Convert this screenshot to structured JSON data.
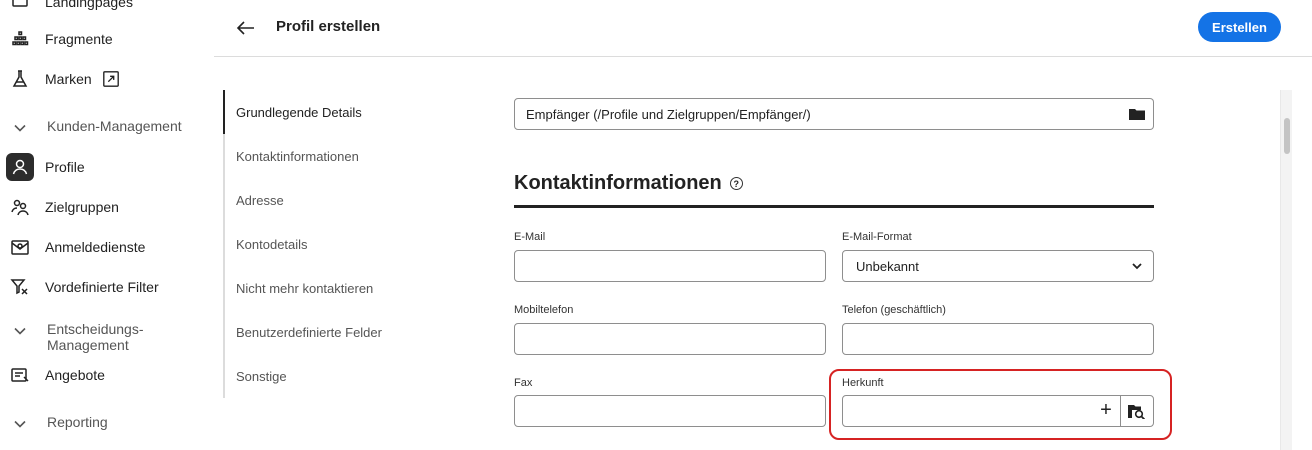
{
  "nav": {
    "items": [
      {
        "label": "Landingpages",
        "icon": "landing-page-icon"
      },
      {
        "label": "Fragmente",
        "icon": "fragment-icon"
      },
      {
        "label": "Marken",
        "icon": "brand-flask-icon"
      },
      {
        "label": "Profile",
        "icon": "user-icon",
        "active": true
      },
      {
        "label": "Zielgruppen",
        "icon": "audience-icon"
      },
      {
        "label": "Anmeldedienste",
        "icon": "subscription-icon"
      },
      {
        "label": "Vordefinierte Filter",
        "icon": "filter-icon"
      },
      {
        "label": "Angebote",
        "icon": "offer-icon"
      }
    ],
    "sections": [
      {
        "label": "Kunden-Management"
      },
      {
        "label": "Entscheidungs-\nManagement"
      },
      {
        "label": "Reporting"
      }
    ]
  },
  "header": {
    "title": "Profil erstellen",
    "create_label": "Erstellen"
  },
  "section_nav": {
    "items": [
      {
        "label": "Grundlegende Details",
        "active": true
      },
      {
        "label": "Kontaktinformationen"
      },
      {
        "label": "Adresse"
      },
      {
        "label": "Kontodetails"
      },
      {
        "label": "Nicht mehr kontaktieren"
      },
      {
        "label": "Benutzerdefinierte Felder"
      },
      {
        "label": "Sonstige"
      }
    ]
  },
  "form": {
    "folder_value": "Empfänger (/Profile und Zielgruppen/Empfänger/)",
    "section_title": "Kontaktinformationen",
    "help_glyph": "?",
    "fields": {
      "email": {
        "label": "E-Mail",
        "value": ""
      },
      "email_format": {
        "label": "E-Mail-Format",
        "value": "Unbekannt"
      },
      "mobile": {
        "label": "Mobiltelefon",
        "value": ""
      },
      "phone_business": {
        "label": "Telefon (geschäftlich)",
        "value": ""
      },
      "fax": {
        "label": "Fax",
        "value": ""
      },
      "origin": {
        "label": "Herkunft",
        "value": ""
      }
    },
    "plus_glyph": "+"
  },
  "colors": {
    "accent": "#1473e6",
    "highlight": "#d62323"
  }
}
